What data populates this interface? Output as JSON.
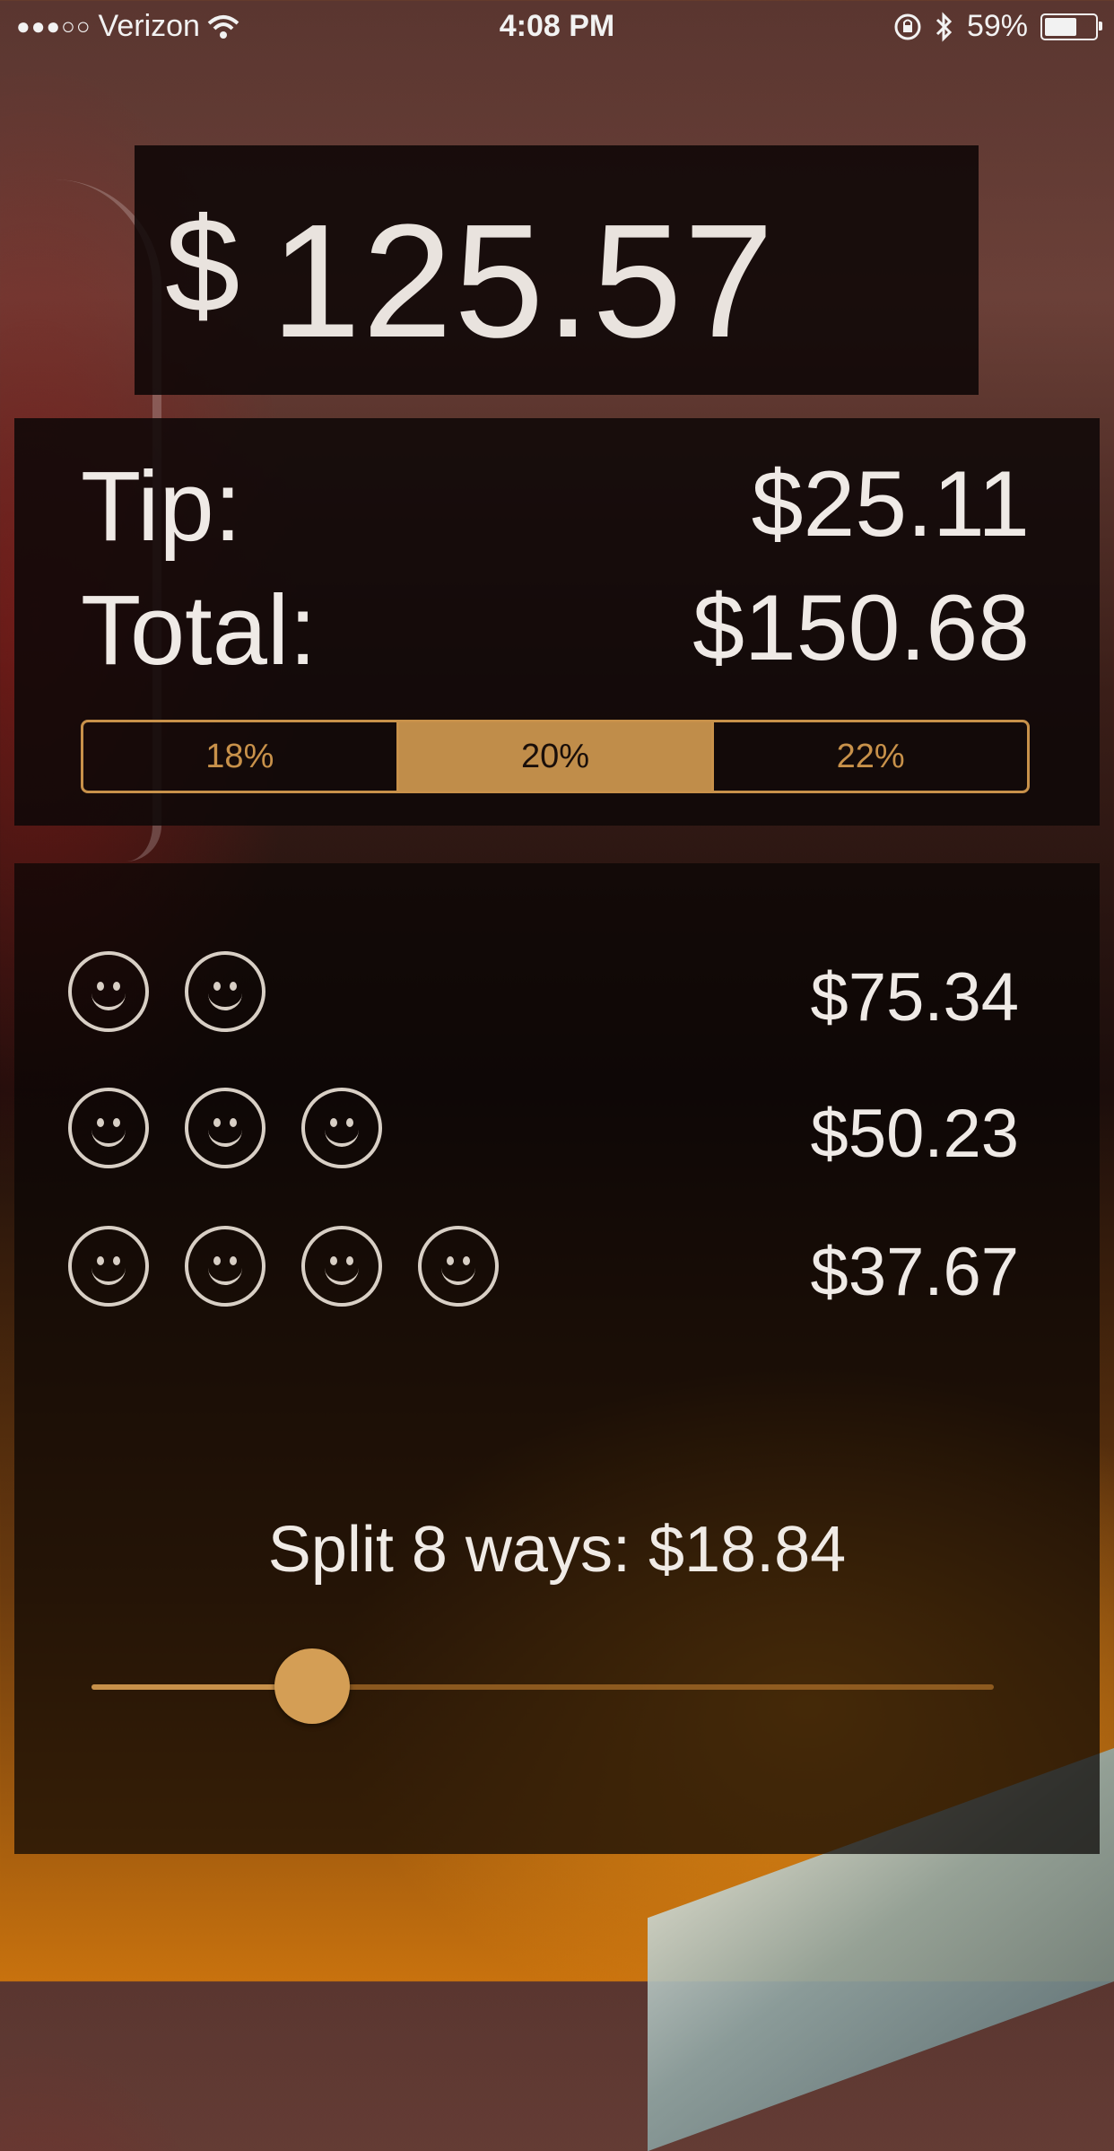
{
  "status_bar": {
    "signal": "●●●○○",
    "carrier": "Verizon",
    "time": "4:08 PM",
    "battery_percent": "59%"
  },
  "bill": {
    "currency": "$",
    "amount": "125.57"
  },
  "results": {
    "tip_label": "Tip:",
    "tip_value": "$25.11",
    "total_label": "Total:",
    "total_value": "$150.68"
  },
  "tip_options": {
    "options": [
      "18%",
      "20%",
      "22%"
    ],
    "selected": "20%"
  },
  "split_groups": [
    {
      "people": 2,
      "amount": "$75.34"
    },
    {
      "people": 3,
      "amount": "$50.23"
    },
    {
      "people": 4,
      "amount": "$37.67"
    }
  ],
  "split": {
    "text": "Split 8 ways: $18.84",
    "slider_fraction": 0.25
  },
  "colors": {
    "accent": "#c8914a",
    "text": "#efeae6"
  }
}
